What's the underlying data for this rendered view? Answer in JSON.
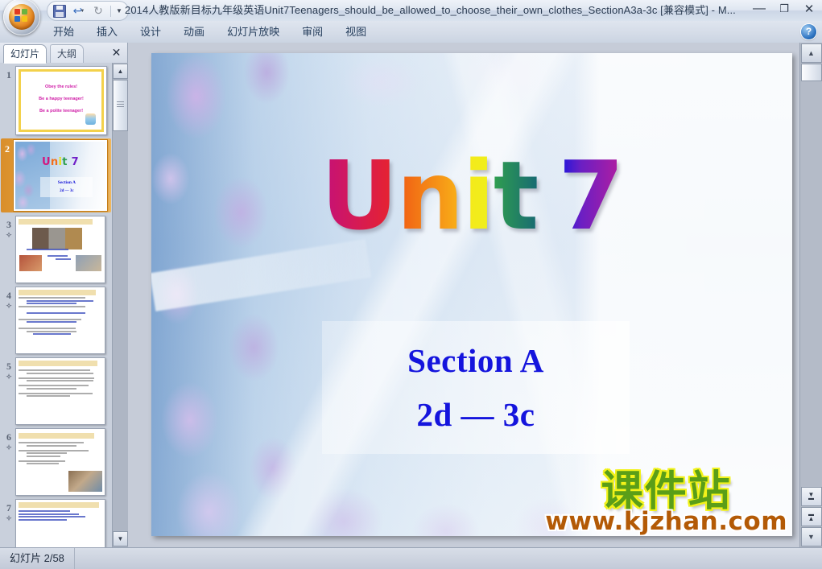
{
  "window": {
    "title": "2014人教版新目标九年级英语Unit7Teenagers_should_be_allowed_to_choose_their_own_clothes_SectionA3a-3c [兼容模式] - M...",
    "minimize_label": "—",
    "restore_label": "❐",
    "close_label": "✕"
  },
  "quick_access": {
    "office_button": "office-orb",
    "save_label": "保存",
    "undo_label": "撤消",
    "redo_label": "恢复",
    "customize_label": "自定义快速访问工具栏"
  },
  "ribbon": {
    "tabs": [
      {
        "label": "开始"
      },
      {
        "label": "插入"
      },
      {
        "label": "设计"
      },
      {
        "label": "动画"
      },
      {
        "label": "幻灯片放映"
      },
      {
        "label": "审阅"
      },
      {
        "label": "视图"
      }
    ],
    "help_label": "?"
  },
  "left_pane": {
    "tabs": [
      {
        "label": "幻灯片",
        "active": true
      },
      {
        "label": "大纲",
        "active": false
      }
    ],
    "close_label": "✕",
    "slides": [
      {
        "number": "1",
        "has_animation": false,
        "selected": false,
        "lines": [
          "Obey the rules!",
          "Be a happy teenager!",
          "Be a polite teenager!"
        ]
      },
      {
        "number": "2",
        "has_animation": false,
        "selected": true,
        "title": "Unit 7",
        "sub1": "Section A",
        "sub2": "2d — 3c"
      },
      {
        "number": "3",
        "has_animation": true,
        "selected": false,
        "kind": "pictures"
      },
      {
        "number": "4",
        "has_animation": true,
        "selected": false,
        "kind": "text"
      },
      {
        "number": "5",
        "has_animation": true,
        "selected": false,
        "kind": "text"
      },
      {
        "number": "6",
        "has_animation": true,
        "selected": false,
        "kind": "text-photo"
      },
      {
        "number": "7",
        "has_animation": true,
        "selected": false,
        "kind": "text"
      }
    ],
    "scroll_up": "▲",
    "scroll_down": "▼"
  },
  "slide": {
    "wordart": {
      "letters": [
        {
          "ch": "U",
          "color": "#cc1177"
        },
        {
          "ch": "n",
          "color": "#f2701c"
        },
        {
          "ch": "i",
          "color": "#f2ea1a"
        },
        {
          "ch": "t",
          "color": "#2f9e4f"
        },
        {
          "ch": " ",
          "color": "#ffffff"
        },
        {
          "ch": "7",
          "color": "#6a1fc4"
        }
      ],
      "text": "Unit 7"
    },
    "section_line1": "Section A",
    "section_line2": "2d — 3c",
    "watermark_cn": "课件站",
    "watermark_url": "www.kjzhan.com",
    "watermark_color": "#5a9e18",
    "watermark_url_color": "#b35a06"
  },
  "right_scrollbar": {
    "up": "▲",
    "down": "▼",
    "prev_slide": "▲",
    "next_slide": "▼"
  },
  "status_bar": {
    "slide_counter": "幻灯片 2/58"
  },
  "colors": {
    "accent_blue": "#1414dd",
    "selection_gold": "#e8a63f",
    "chrome": "#c9d0dc"
  }
}
